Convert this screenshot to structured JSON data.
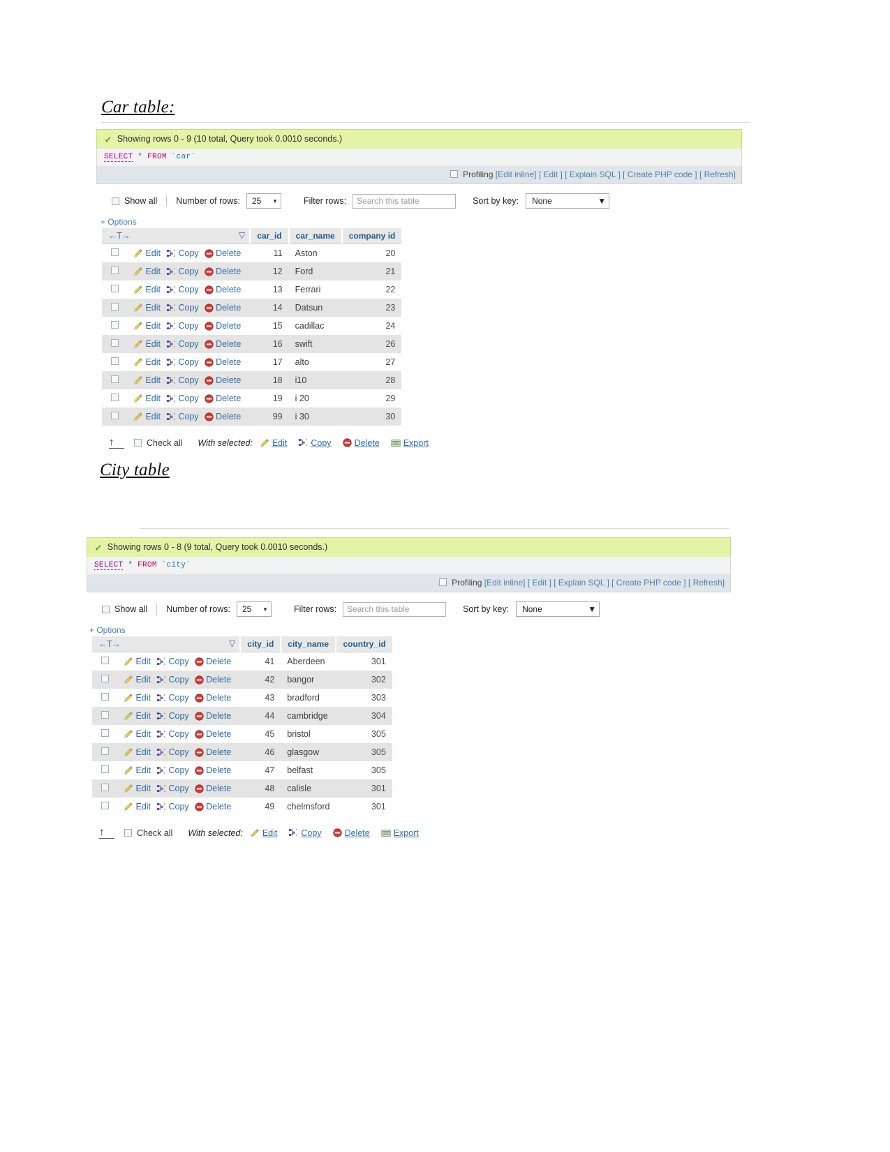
{
  "sections": [
    {
      "id": "car",
      "heading": "Car table:",
      "status": "Showing rows 0 - 9 (10 total, Query took 0.0010 seconds.)",
      "sql": {
        "select": "SELECT",
        "star": "*",
        "from": "FROM",
        "ident": "`car`"
      },
      "actions": {
        "profiling_label": "Profiling",
        "links": [
          "[Edit inline]",
          "[ Edit ]",
          "[ Explain SQL ]",
          "[ Create PHP code ]",
          "[ Refresh]"
        ]
      },
      "toolbar": {
        "show_all": "Show all",
        "number_of_rows_label": "Number of rows:",
        "number_of_rows_value": "25",
        "filter_rows_label": "Filter rows:",
        "filter_placeholder": "Search this table",
        "filter_value": "",
        "sort_by_key_label": "Sort by key:",
        "sort_by_key_value": "None"
      },
      "options_link": "+ Options",
      "row_actions": {
        "edit": "Edit",
        "copy": "Copy",
        "delete": "Delete"
      },
      "columns": [
        "car_id",
        "car_name",
        "company id"
      ],
      "rows": [
        {
          "id": "11",
          "name": "Aston",
          "company": "20"
        },
        {
          "id": "12",
          "name": "Ford",
          "company": "21"
        },
        {
          "id": "13",
          "name": "Ferrari",
          "company": "22"
        },
        {
          "id": "14",
          "name": "Datsun",
          "company": "23"
        },
        {
          "id": "15",
          "name": "cadillac",
          "company": "24"
        },
        {
          "id": "16",
          "name": "swift",
          "company": "26"
        },
        {
          "id": "17",
          "name": "alto",
          "company": "27"
        },
        {
          "id": "18",
          "name": "i10",
          "company": "28"
        },
        {
          "id": "19",
          "name": "i 20",
          "company": "29"
        },
        {
          "id": "99",
          "name": "i 30",
          "company": "30"
        }
      ],
      "footer": {
        "check_all": "Check all",
        "with_selected": "With selected:",
        "edit": "Edit",
        "copy": "Copy",
        "delete": "Delete",
        "export": "Export"
      }
    },
    {
      "id": "city",
      "heading": "City table",
      "status": "Showing rows 0 - 8 (9 total, Query took 0.0010 seconds.)",
      "sql": {
        "select": "SELECT",
        "star": "*",
        "from": "FROM",
        "ident": "`city`"
      },
      "actions": {
        "profiling_label": "Profiling",
        "links": [
          "[Edit inline]",
          "[ Edit ]",
          "[ Explain SQL ]",
          "[ Create PHP code ]",
          "[ Refresh]"
        ]
      },
      "toolbar": {
        "show_all": "Show all",
        "number_of_rows_label": "Number of rows:",
        "number_of_rows_value": "25",
        "filter_rows_label": "Filter rows:",
        "filter_placeholder": "Search this table",
        "filter_value": "",
        "sort_by_key_label": "Sort by key:",
        "sort_by_key_value": "None"
      },
      "options_link": "+ Options",
      "row_actions": {
        "edit": "Edit",
        "copy": "Copy",
        "delete": "Delete"
      },
      "columns": [
        "city_id",
        "city_name",
        "country_id"
      ],
      "rows": [
        {
          "id": "41",
          "name": "Aberdeen",
          "company": "301"
        },
        {
          "id": "42",
          "name": "bangor",
          "company": "302"
        },
        {
          "id": "43",
          "name": "bradford",
          "company": "303"
        },
        {
          "id": "44",
          "name": "cambridge",
          "company": "304"
        },
        {
          "id": "45",
          "name": "bristol",
          "company": "305"
        },
        {
          "id": "46",
          "name": "glasgow",
          "company": "305"
        },
        {
          "id": "47",
          "name": "belfast",
          "company": "305"
        },
        {
          "id": "48",
          "name": "calisle",
          "company": "301"
        },
        {
          "id": "49",
          "name": "chelmsford",
          "company": "301"
        }
      ],
      "footer": {
        "check_all": "Check all",
        "with_selected": "With selected:",
        "edit": "Edit",
        "copy": "Copy",
        "delete": "Delete",
        "export": "Export"
      }
    }
  ],
  "colors": {
    "success_bg": "#e4f3a5",
    "link": "#2f6ca3",
    "header_text": "#1f5c8b",
    "action_bar_bg": "#dfe5e9"
  }
}
